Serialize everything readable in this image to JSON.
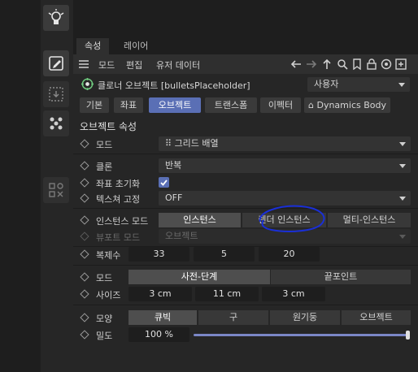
{
  "panel_tabs": [
    "속성",
    "레이어"
  ],
  "menu": [
    "모드",
    "편집",
    "유저 데이터"
  ],
  "object": {
    "title": "클로너 오브젝트 [bulletsPlaceholder]",
    "user_dropdown": "사용자"
  },
  "object_tabs": [
    "기본",
    "좌표",
    "오브젝트",
    "트랜스폼",
    "이펙터",
    "Dynamics Body"
  ],
  "active_object_tab": "오브젝트",
  "section_title": "오브젝트 속성",
  "rows": {
    "mode": {
      "label": "모드",
      "value": "그리드 배열"
    },
    "clone": {
      "label": "클론",
      "value": "반복"
    },
    "reset_coords": {
      "label": "좌표 초기화",
      "checked": true
    },
    "fix_texture": {
      "label": "텍스쳐 고정",
      "value": "OFF"
    },
    "instance_mode": {
      "label": "인스턴스 모드",
      "options": [
        "인스턴스",
        "렌더 인스턴스",
        "멀티-인스턴스"
      ],
      "selected": "인스턴스"
    },
    "viewport_mode": {
      "label": "뷰포트 모드",
      "value": "오브젝트"
    },
    "count": {
      "label": "복제수",
      "values": [
        "33",
        "5",
        "20"
      ]
    },
    "mode2": {
      "label": "모드",
      "options": [
        "사전-단계",
        "끝포인트"
      ],
      "selected": "사전-단계"
    },
    "size": {
      "label": "사이즈",
      "values": [
        "3 cm",
        "11 cm",
        "3 cm"
      ]
    },
    "shape": {
      "label": "모양",
      "options": [
        "큐빅",
        "구",
        "원기둥",
        "오브젝트"
      ],
      "selected": "큐빅"
    },
    "density": {
      "label": "밀도",
      "value": "100 %",
      "level": 1.0
    }
  },
  "colors": {
    "accent": "#5a6fb5",
    "annotation": "#1a2fd6"
  }
}
